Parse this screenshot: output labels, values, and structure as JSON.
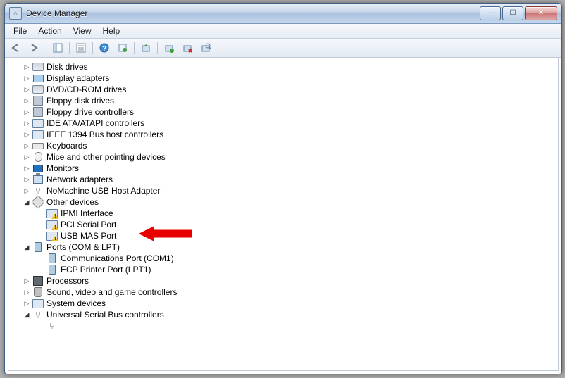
{
  "window": {
    "title": "Device Manager"
  },
  "menubar": {
    "file": "File",
    "action": "Action",
    "view": "View",
    "help": "Help"
  },
  "toolbar": {
    "back": "Back",
    "forward": "Forward",
    "show_hide_tree": "Show/Hide Console Tree",
    "properties": "Properties",
    "help": "Help",
    "refresh": "Refresh",
    "update_driver": "Update Driver Software",
    "enable": "Enable",
    "uninstall": "Uninstall",
    "scan": "Scan for hardware changes"
  },
  "annotation": {
    "type": "arrow",
    "target": "USB MAS Port",
    "color": "#e80000"
  },
  "tree": {
    "items": [
      {
        "label": "Disk drives",
        "icon": "disk",
        "state": "collapsed"
      },
      {
        "label": "Display adapters",
        "icon": "display",
        "state": "collapsed"
      },
      {
        "label": "DVD/CD-ROM drives",
        "icon": "disk",
        "state": "collapsed"
      },
      {
        "label": "Floppy disk drives",
        "icon": "floppy",
        "state": "collapsed"
      },
      {
        "label": "Floppy drive controllers",
        "icon": "floppy",
        "state": "collapsed"
      },
      {
        "label": "IDE ATA/ATAPI controllers",
        "icon": "device",
        "state": "collapsed"
      },
      {
        "label": "IEEE 1394 Bus host controllers",
        "icon": "device",
        "state": "collapsed"
      },
      {
        "label": "Keyboards",
        "icon": "kb",
        "state": "collapsed"
      },
      {
        "label": "Mice and other pointing devices",
        "icon": "mouse",
        "state": "collapsed"
      },
      {
        "label": "Monitors",
        "icon": "monitor",
        "state": "collapsed"
      },
      {
        "label": "Network adapters",
        "icon": "net",
        "state": "collapsed"
      },
      {
        "label": "NoMachine USB Host Adapter",
        "icon": "usb",
        "state": "collapsed"
      },
      {
        "label": "Other devices",
        "icon": "other",
        "state": "expanded",
        "children": [
          {
            "label": "IPMI Interface",
            "icon": "warn",
            "state": "leaf"
          },
          {
            "label": "PCI Serial Port",
            "icon": "warn",
            "state": "leaf"
          },
          {
            "label": "USB MAS Port",
            "icon": "warn",
            "state": "leaf"
          }
        ]
      },
      {
        "label": "Ports (COM & LPT)",
        "icon": "port",
        "state": "expanded",
        "children": [
          {
            "label": "Communications Port (COM1)",
            "icon": "port",
            "state": "leaf"
          },
          {
            "label": "ECP Printer Port (LPT1)",
            "icon": "port",
            "state": "leaf"
          }
        ]
      },
      {
        "label": "Processors",
        "icon": "cpu",
        "state": "collapsed"
      },
      {
        "label": "Sound, video and game controllers",
        "icon": "sound",
        "state": "collapsed"
      },
      {
        "label": "System devices",
        "icon": "device",
        "state": "collapsed"
      },
      {
        "label": "Universal Serial Bus controllers",
        "icon": "usb",
        "state": "expanded",
        "children": [
          {
            "label": "",
            "icon": "usb",
            "state": "leaf"
          }
        ]
      }
    ]
  }
}
